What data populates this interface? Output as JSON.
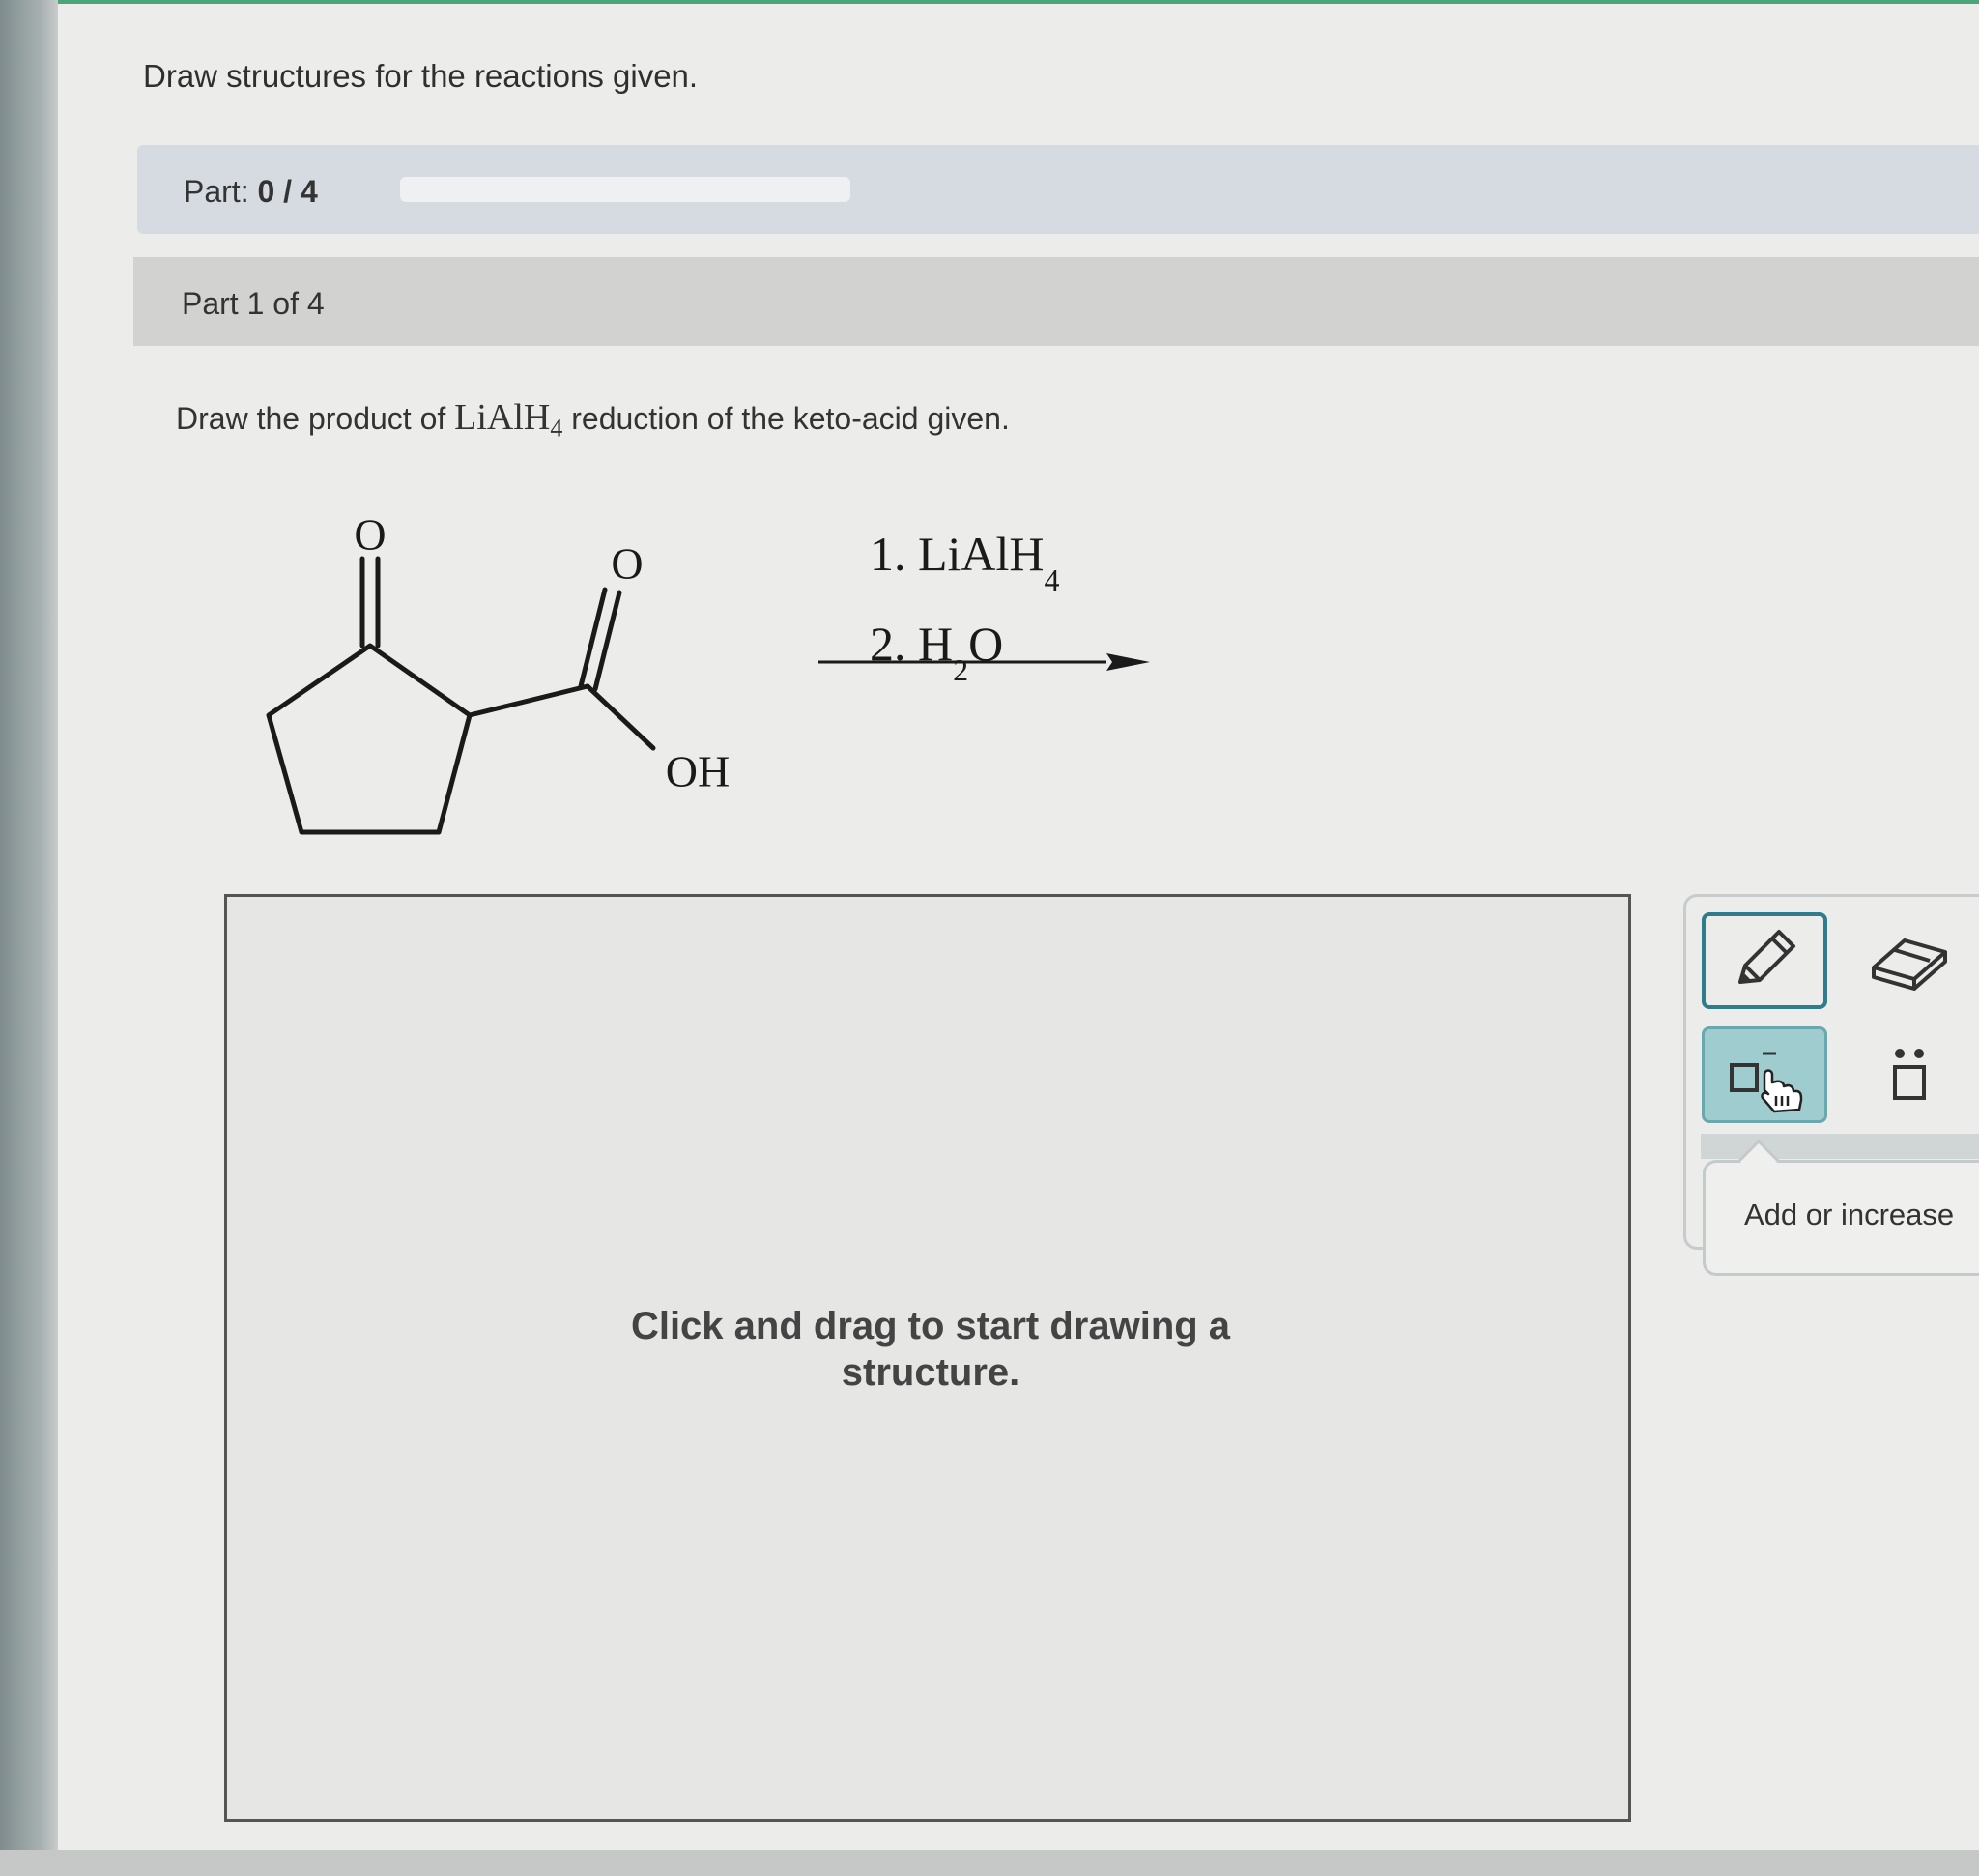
{
  "instructions": "Draw structures for the reactions given.",
  "progress": {
    "label": "Part:",
    "value": "0 / 4",
    "fraction_complete": 0
  },
  "part_header": "Part 1 of 4",
  "question": {
    "prefix": "Draw the product of ",
    "reagent_main": "LiAlH",
    "reagent_sub": "4",
    "suffix": " reduction of the keto-acid given."
  },
  "structure": {
    "ketone_o": "O",
    "acid_o": "O",
    "hydroxyl": "OH"
  },
  "reagents": {
    "step1_main": "1. LiAlH",
    "step1_sub": "4",
    "step2_main": "2. H",
    "step2_sub": "2",
    "step2_tail": "O"
  },
  "canvas": {
    "prompt_line1": "Click and drag to start drawing a",
    "prompt_line2": "structure."
  },
  "toolbar": {
    "tools": [
      "pencil-icon",
      "eraser-icon",
      "charge-icon",
      "lone-pair-icon"
    ],
    "tooltip": "Add or increase"
  },
  "colors": {
    "accent": "#2f7c8c",
    "selected_tool_bg": "#9fcdcf",
    "progress_fill": "#4aa57a"
  }
}
